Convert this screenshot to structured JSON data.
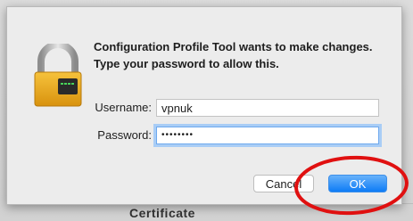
{
  "background": {
    "text": "Certificate"
  },
  "dialog": {
    "message": "Configuration Profile Tool wants to make changes. Type your password to allow this.",
    "username_label": "Username:",
    "username_value": "vpnuk",
    "password_label": "Password:",
    "password_value": "••••••••",
    "cancel_label": "Cancel",
    "ok_label": "OK",
    "icon": "lock-icon"
  },
  "annotation": {
    "color": "#e01010",
    "shape": "ellipse-highlight"
  }
}
